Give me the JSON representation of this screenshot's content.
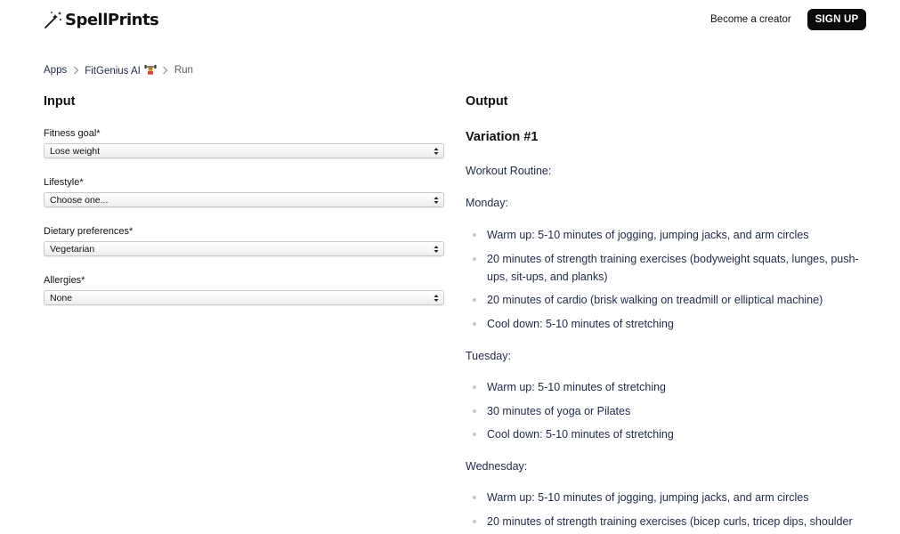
{
  "header": {
    "brand": "SpellPrints",
    "become_creator": "Become a creator",
    "signup": "SIGN UP"
  },
  "breadcrumb": {
    "items": [
      "Apps",
      "FitGenius AI",
      "Run"
    ]
  },
  "input": {
    "title": "Input",
    "fields": [
      {
        "label": "Fitness goal*",
        "value": "Lose weight"
      },
      {
        "label": "Lifestyle*",
        "value": "Choose one..."
      },
      {
        "label": "Dietary preferences*",
        "value": "Vegetarian"
      },
      {
        "label": "Allergies*",
        "value": "None"
      }
    ]
  },
  "output": {
    "title": "Output",
    "variation": "Variation #1",
    "routine_heading": "Workout Routine:",
    "days": [
      {
        "name": "Monday:",
        "items": [
          "Warm up: 5-10 minutes of jogging, jumping jacks, and arm circles",
          "20 minutes of strength training exercises (bodyweight squats, lunges, push-ups, sit-ups, and planks)",
          "20 minutes of cardio (brisk walking on treadmill or elliptical machine)",
          "Cool down: 5-10 minutes of stretching"
        ]
      },
      {
        "name": "Tuesday:",
        "items": [
          "Warm up: 5-10 minutes of stretching",
          "30 minutes of yoga or Pilates",
          "Cool down: 5-10 minutes of stretching"
        ]
      },
      {
        "name": "Wednesday:",
        "items": [
          "Warm up: 5-10 minutes of jogging, jumping jacks, and arm circles",
          "20 minutes of strength training exercises (bicep curls, tricep dips, shoulder"
        ]
      }
    ]
  },
  "icons": {
    "logo": "magic-wand-icon",
    "breadcrumb_separator": "chevron-right-icon",
    "select_arrow": "up-down-arrows-icon",
    "app_emoji": "robot-weightlifter-emoji"
  },
  "colors": {
    "brand_button": "#0b0b0b",
    "text_primary": "#111111",
    "text_output": "#1f2a44",
    "bullet": "#c3c7ce"
  }
}
